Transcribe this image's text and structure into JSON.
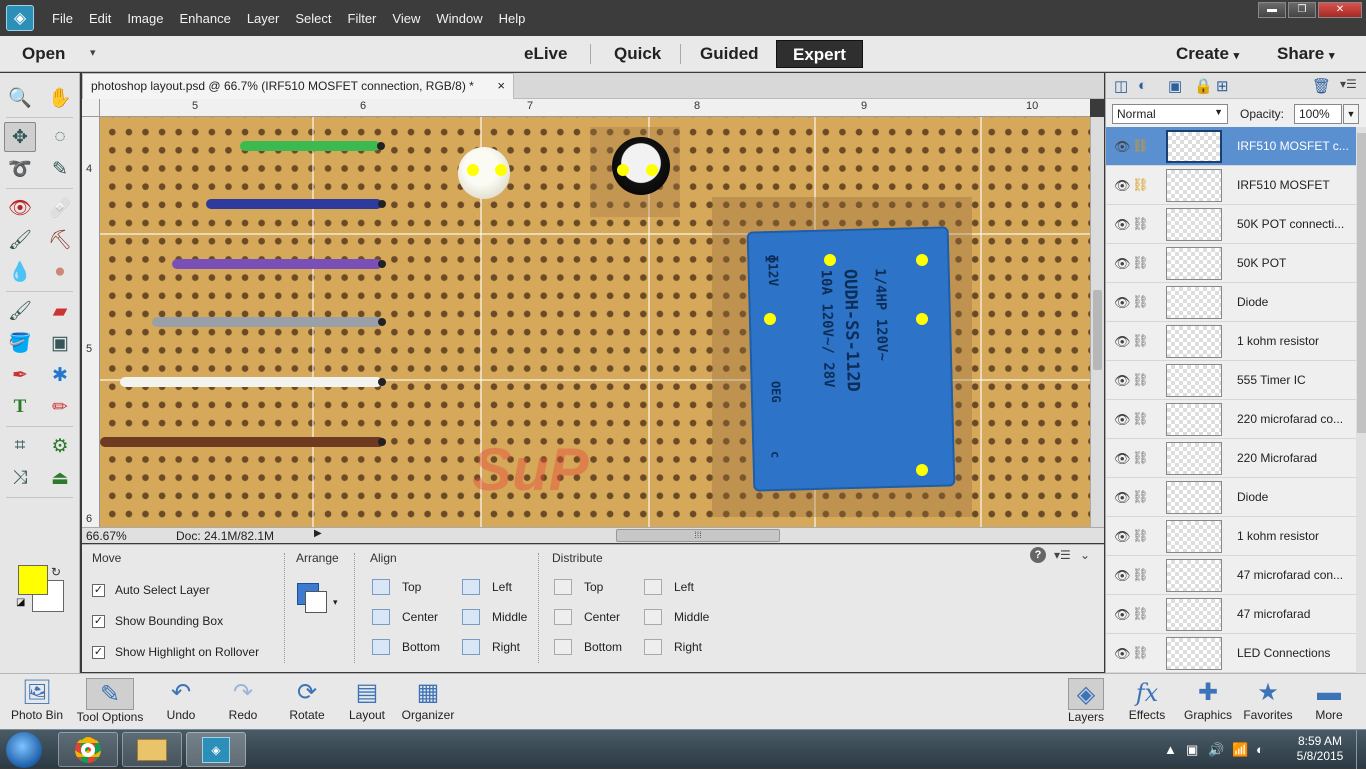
{
  "menu": {
    "items": [
      "File",
      "Edit",
      "Image",
      "Enhance",
      "Layer",
      "Select",
      "Filter",
      "View",
      "Window",
      "Help"
    ]
  },
  "window_controls": {
    "minimize": "▬",
    "restore": "❐",
    "close": "✕"
  },
  "modebar": {
    "open": "Open",
    "modes": [
      "eLive",
      "Quick",
      "Guided",
      "Expert"
    ],
    "active_mode": "Expert",
    "create": "Create",
    "share": "Share"
  },
  "document": {
    "tab_title": "photoshop layout.psd @ 66.7% (IRF510 MOSFET connection, RGB/8) *",
    "close": "×"
  },
  "rulers": {
    "top": [
      "5",
      "6",
      "7",
      "8",
      "9",
      "10"
    ],
    "left": [
      "4",
      "5",
      "6"
    ]
  },
  "canvas": {
    "relay_lines": [
      "ɸ12V",
      "10A 120V~/ 28V",
      "OUDH-SS-112D",
      "1/4HP 120V~",
      "OEG",
      "c"
    ],
    "watermark": "SuP"
  },
  "status": {
    "zoom": "66.67%",
    "doc": "Doc: 24.1M/82.1M"
  },
  "tool_options": {
    "move_title": "Move",
    "checkboxes": [
      {
        "label": "Auto Select Layer",
        "checked": true
      },
      {
        "label": "Show Bounding Box",
        "checked": true
      },
      {
        "label": "Show Highlight on Rollover",
        "checked": true
      }
    ],
    "arrange_title": "Arrange",
    "align_title": "Align",
    "align": [
      "Top",
      "Center",
      "Bottom",
      "Left",
      "Middle",
      "Right"
    ],
    "distribute_title": "Distribute",
    "distribute": [
      "Top",
      "Center",
      "Bottom",
      "Left",
      "Middle",
      "Right"
    ]
  },
  "colors": {
    "foreground": "#ffff00",
    "background": "#ffffff"
  },
  "layers_panel": {
    "blend_mode": "Normal",
    "opacity_label": "Opacity:",
    "opacity_value": "100%",
    "layers": [
      "IRF510 MOSFET c...",
      "IRF510 MOSFET",
      "50K POT connecti...",
      "50K POT",
      "Diode",
      "1 kohm resistor",
      "555 Timer IC",
      "220 microfarad co...",
      "220 Microfarad",
      "Diode",
      "1 kohm resistor",
      "47 microfarad con...",
      "47 microfarad",
      "LED Connections"
    ],
    "selected_index": 0
  },
  "appbar": {
    "left": [
      "Photo Bin",
      "Tool Options",
      "Undo",
      "Redo",
      "Rotate",
      "Layout",
      "Organizer"
    ],
    "right": [
      "Layers",
      "Effects",
      "Graphics",
      "Favorites",
      "More"
    ],
    "selected": "Tool Options"
  },
  "taskbar": {
    "time": "8:59 AM",
    "date": "5/8/2015"
  }
}
